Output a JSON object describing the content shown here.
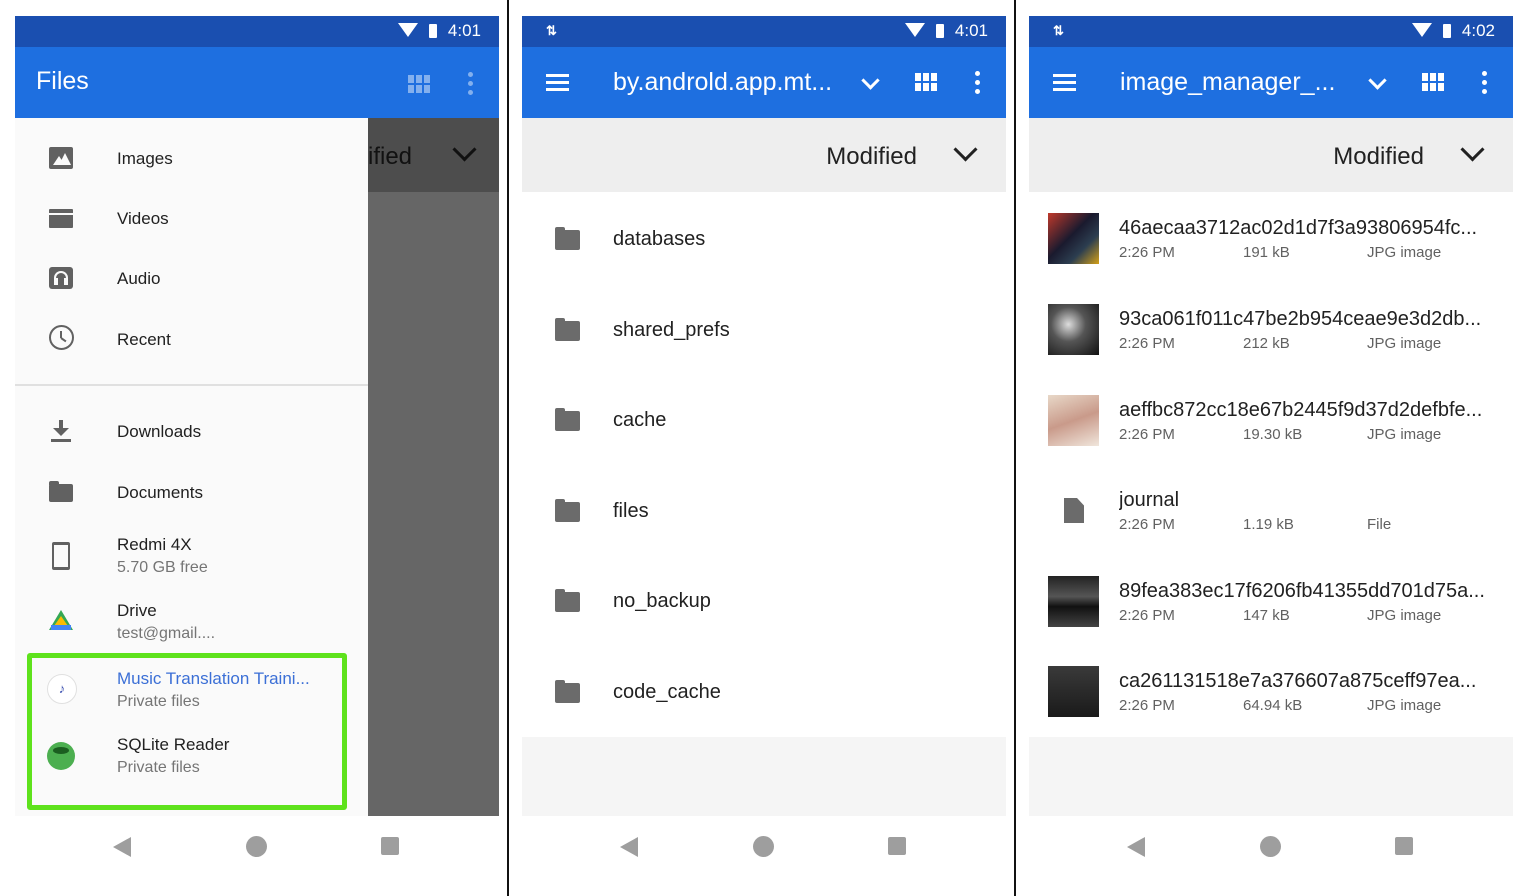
{
  "screens": [
    {
      "status_time": "4:01",
      "drawer_title": "Files",
      "behind_sort_label": "ified",
      "drawer_items": [
        {
          "label": "Images",
          "icon": "image-icon"
        },
        {
          "label": "Videos",
          "icon": "video-icon"
        },
        {
          "label": "Audio",
          "icon": "audio-icon"
        },
        {
          "label": "Recent",
          "icon": "clock-icon"
        },
        {
          "label": "Downloads",
          "icon": "download-icon"
        },
        {
          "label": "Documents",
          "icon": "folder-icon"
        },
        {
          "label": "Redmi 4X",
          "sub": "5.70 GB free",
          "icon": "phone-icon"
        },
        {
          "label": "Drive",
          "sub": "test@gmail....",
          "icon": "drive-icon"
        },
        {
          "label": "Music Translation Traini...",
          "sub": "Private files",
          "icon": "music-translation-app-icon"
        },
        {
          "label": "SQLite Reader",
          "sub": "Private files",
          "icon": "sqlite-reader-app-icon"
        }
      ]
    },
    {
      "status_time": "4:01",
      "title": "by.androld.app.mt...",
      "sort_label": "Modified",
      "folders": [
        "databases",
        "shared_prefs",
        "cache",
        "files",
        "no_backup",
        "code_cache"
      ]
    },
    {
      "status_time": "4:02",
      "title": "image_manager_...",
      "sort_label": "Modified",
      "files": [
        {
          "name": "46aecaa3712ac02d1d7f3a93806954fc...",
          "time": "2:26 PM",
          "size": "191 kB",
          "type": "JPG image"
        },
        {
          "name": "93ca061f011c47be2b954ceae9e3d2db...",
          "time": "2:26 PM",
          "size": "212 kB",
          "type": "JPG image"
        },
        {
          "name": "aeffbc872cc18e67b2445f9d37d2defbfe...",
          "time": "2:26 PM",
          "size": "19.30 kB",
          "type": "JPG image"
        },
        {
          "name": "journal",
          "time": "2:26 PM",
          "size": "1.19 kB",
          "type": "File"
        },
        {
          "name": "89fea383ec17f6206fb41355dd701d75a...",
          "time": "2:26 PM",
          "size": "147 kB",
          "type": "JPG image"
        },
        {
          "name": "ca261131518e7a376607a875ceff97ea...",
          "time": "2:26 PM",
          "size": "64.94 kB",
          "type": "JPG image"
        }
      ]
    }
  ],
  "colors": {
    "statusbar": "#1a4fb0",
    "appbar": "#1e6fe0",
    "highlight": "#5ee21c",
    "link": "#3b6fd6"
  }
}
